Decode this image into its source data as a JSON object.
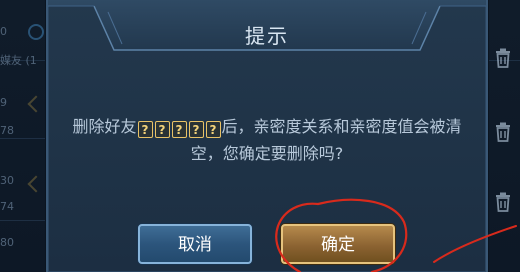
{
  "background": {
    "left_fragments": [
      "0",
      "媒友 (1",
      "9",
      "78",
      "30",
      "74",
      "80"
    ],
    "trash_icon": "trash-icon"
  },
  "dialog": {
    "title": "提示",
    "message_prefix": "删除好友",
    "name_glyphs": [
      "?",
      "?",
      "?",
      "?",
      "?"
    ],
    "message_suffix": "后，亲密度关系和亲密度值会被清空，您确定要删除吗?",
    "cancel_label": "取消",
    "confirm_label": "确定"
  },
  "colors": {
    "confirm_accent": "#e6c37d",
    "cancel_accent": "#86b3da",
    "annotation": "#d82a1c"
  }
}
